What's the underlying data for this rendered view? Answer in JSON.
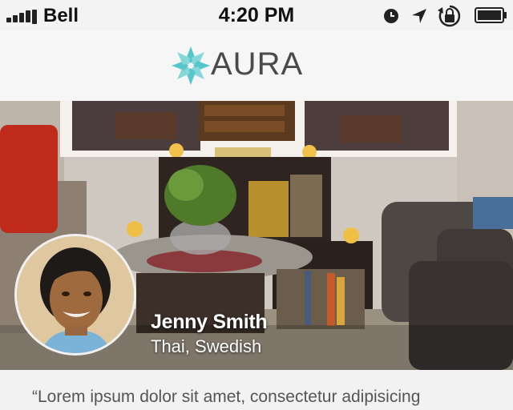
{
  "status_bar": {
    "carrier": "Bell",
    "time": "4:20 PM",
    "icons": [
      "signal-bars",
      "clock-icon",
      "location-arrow-icon",
      "rotation-lock-icon",
      "battery-icon"
    ]
  },
  "header": {
    "brand": "AURA",
    "logo_icon": "flower-icon",
    "brand_color": "#4dc5c9"
  },
  "profile": {
    "name": "Jenny Smith",
    "cuisines": "Thai, Swedish"
  },
  "quote": {
    "text": "“Lorem ipsum dolor sit amet, consectetur adipisicing"
  }
}
